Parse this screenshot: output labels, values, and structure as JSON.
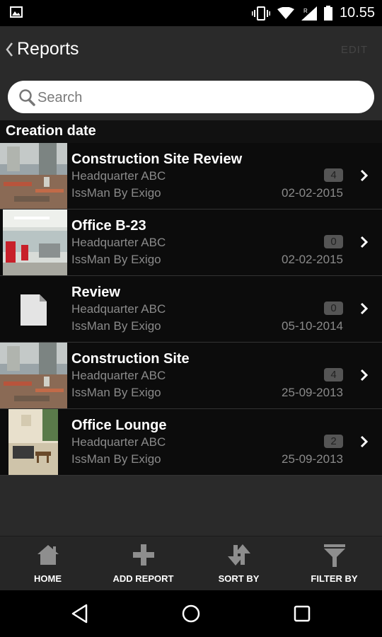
{
  "status_bar": {
    "time": "10.55",
    "icons": [
      "gallery-icon",
      "vibrate-icon",
      "wifi-icon",
      "signal-icon",
      "battery-icon"
    ]
  },
  "header": {
    "title": "Reports",
    "edit_label": "EDIT"
  },
  "search": {
    "placeholder": "Search"
  },
  "section_header": "Creation date",
  "reports": [
    {
      "title": "Construction Site Review",
      "location": "Headquarter ABC",
      "author": "IssMan By Exigo",
      "count": "4",
      "date": "02-02-2015",
      "thumbnail": "construction-photo"
    },
    {
      "title": "Office B-23",
      "location": "Headquarter ABC",
      "author": "IssMan By Exigo",
      "count": "0",
      "date": "02-02-2015",
      "thumbnail": "office-photo"
    },
    {
      "title": "Review",
      "location": "Headquarter ABC",
      "author": "IssMan By Exigo",
      "count": "0",
      "date": "05-10-2014",
      "thumbnail": "document-icon"
    },
    {
      "title": "Construction Site",
      "location": "Headquarter ABC",
      "author": "IssMan By Exigo",
      "count": "4",
      "date": "25-09-2013",
      "thumbnail": "construction-photo"
    },
    {
      "title": "Office Lounge",
      "location": "Headquarter ABC",
      "author": "IssMan By Exigo",
      "count": "2",
      "date": "25-09-2013",
      "thumbnail": "lounge-photo"
    }
  ],
  "bottom_tabs": [
    {
      "label": "HOME",
      "icon": "home-icon"
    },
    {
      "label": "ADD REPORT",
      "icon": "plus-icon"
    },
    {
      "label": "SORT BY",
      "icon": "sort-icon"
    },
    {
      "label": "FILTER BY",
      "icon": "filter-icon"
    }
  ],
  "nav_bar": {
    "icons": [
      "back-triangle-icon",
      "home-circle-icon",
      "recents-square-icon"
    ]
  }
}
